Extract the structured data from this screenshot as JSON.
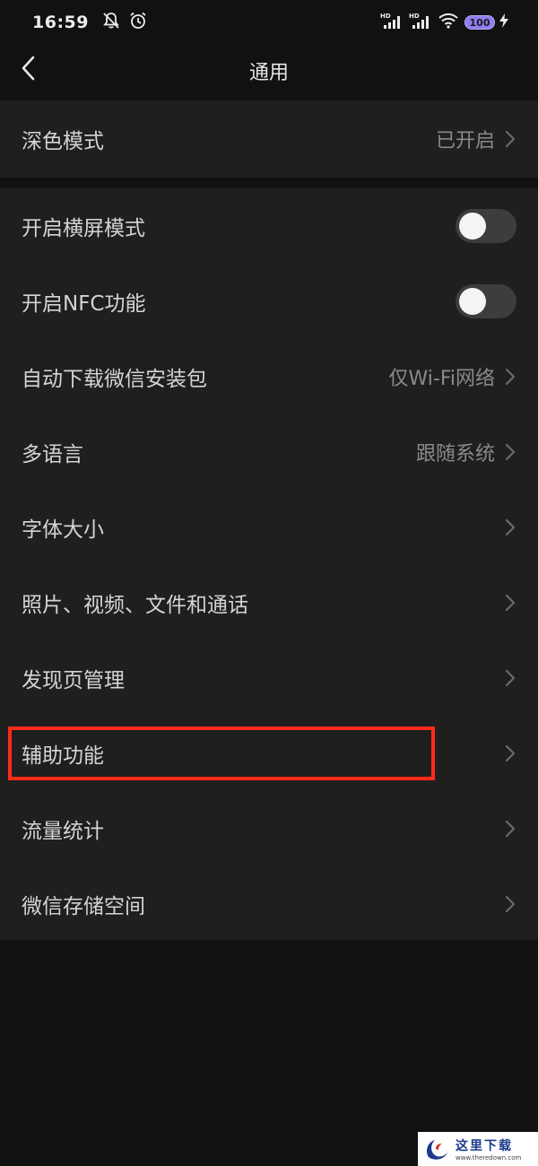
{
  "status_bar": {
    "time": "16:59",
    "battery": "100",
    "hd1": "HD",
    "hd2": "HD"
  },
  "nav": {
    "title": "通用"
  },
  "section1": {
    "dark_mode": {
      "label": "深色模式",
      "value": "已开启"
    }
  },
  "section2": {
    "landscape": {
      "label": "开启横屏模式",
      "enabled": false
    },
    "nfc": {
      "label": "开启NFC功能",
      "enabled": false
    },
    "auto_download": {
      "label": "自动下载微信安装包",
      "value": "仅Wi-Fi网络"
    },
    "language": {
      "label": "多语言",
      "value": "跟随系统"
    },
    "font_size": {
      "label": "字体大小"
    },
    "media": {
      "label": "照片、视频、文件和通话"
    },
    "discover": {
      "label": "发现页管理"
    },
    "accessibility": {
      "label": "辅助功能"
    },
    "traffic": {
      "label": "流量统计"
    },
    "storage": {
      "label": "微信存储空间"
    }
  },
  "watermark": {
    "title": "这里下载",
    "url": "www.theredown.com"
  },
  "colors": {
    "background": "#111111",
    "section": "#1f1f1f",
    "highlight": "#ff2a1a",
    "toggle_off": "#3d3d3d"
  }
}
